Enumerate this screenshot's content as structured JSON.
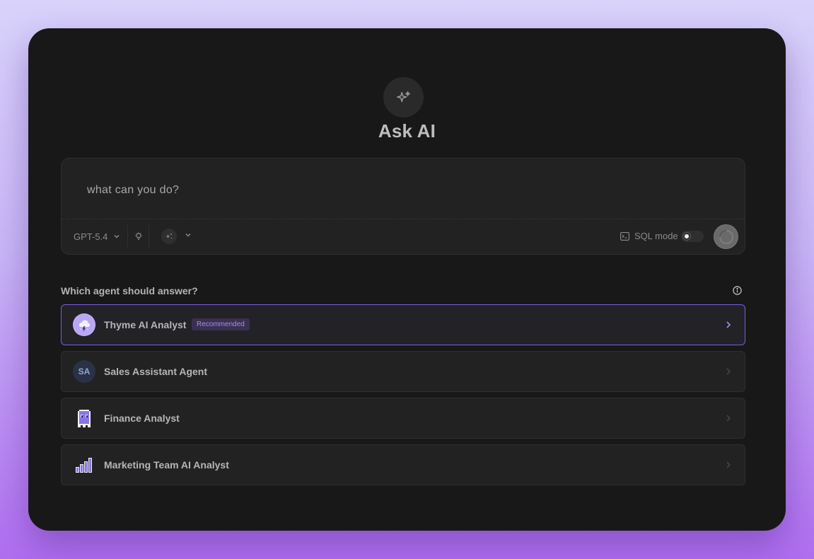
{
  "header": {
    "title": "Ask AI"
  },
  "composer": {
    "query": "what can you do?",
    "model_label": "GPT-5.4",
    "sql_mode_label": "SQL mode"
  },
  "agents": {
    "heading": "Which agent should answer?",
    "items": [
      {
        "name": "Thyme AI Analyst",
        "badge": "Recommended",
        "selected": true
      },
      {
        "name": "Sales Assistant Agent",
        "initials": "SA"
      },
      {
        "name": "Finance Analyst"
      },
      {
        "name": "Marketing Team AI Analyst"
      }
    ]
  },
  "colors": {
    "accent": "#7c5ce6",
    "panel_bg": "#181818",
    "card_bg": "#222222"
  }
}
